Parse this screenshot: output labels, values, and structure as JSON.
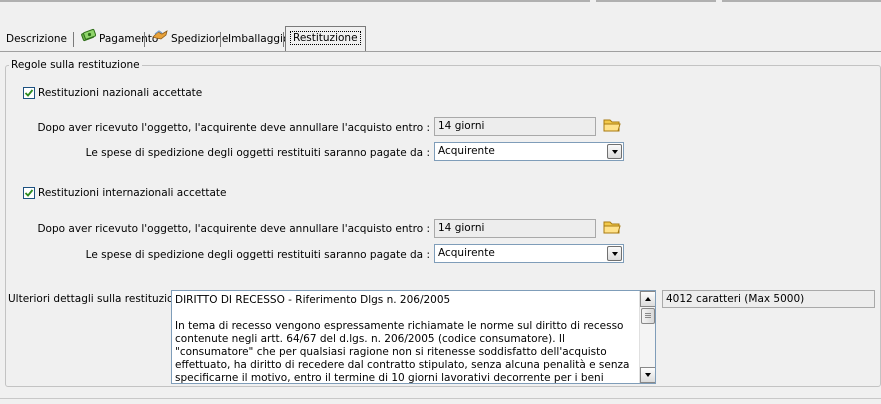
{
  "tabs": [
    {
      "label": "Descrizione",
      "icon": "none"
    },
    {
      "label": "Pagamento",
      "icon": "money-icon"
    },
    {
      "label": "Spedizione",
      "icon": "shipping-icon"
    },
    {
      "label": "Imballaggio",
      "icon": "none"
    },
    {
      "label": "Restituzione",
      "icon": "none",
      "active": true
    }
  ],
  "group": {
    "title": "Regole sulla restituzione"
  },
  "domestic": {
    "checkbox_label": "Restituzioni nazionali accettate",
    "checked": true,
    "period_label": "Dopo aver ricevuto l'oggetto, l'acquirente deve annullare l'acquisto entro :",
    "period_value": "14 giorni",
    "cost_label": "Le spese di spedizione degli oggetti restituiti saranno pagate da :",
    "cost_value": "Acquirente"
  },
  "international": {
    "checkbox_label": "Restituzioni internazionali accettate",
    "checked": true,
    "period_label": "Dopo aver ricevuto l'oggetto, l'acquirente deve annullare l'acquisto entro :",
    "period_value": "14 giorni",
    "cost_label": "Le spese di spedizione degli oggetti restituiti saranno pagate da :",
    "cost_value": "Acquirente"
  },
  "details": {
    "label": "Ulteriori dettagli sulla restituzione :",
    "text": "DIRITTO DI RECESSO - Riferimento Dlgs n. 206/2005\n\nIn tema di recesso vengono espressamente richiamate le norme sul diritto di recesso contenute negli artt. 64/67 del d.lgs. n. 206/2005 (codice consumatore). Il \"consumatore\" che per qualsiasi ragione non si ritenesse soddisfatto dell'acquisto effettuato, ha diritto di recedere dal contratto stipulato, senza alcuna penalità e senza specificarne il motivo, entro il termine di 10 giorni lavorativi decorrente per i beni",
    "counter": "4012 caratteri (Max 5000)"
  },
  "colors": {
    "background": "#f0f0f0",
    "check_green": "#2a8a1e",
    "folder_yellow": "#f2c94c"
  }
}
